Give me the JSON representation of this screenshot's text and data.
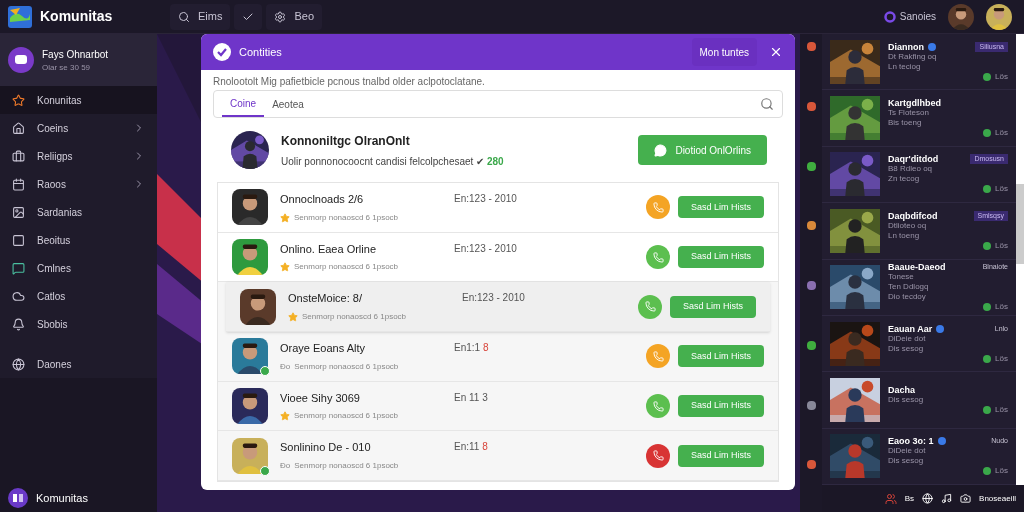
{
  "topbar": {
    "brand": "Komunitas",
    "nav": [
      {
        "label": "Eims"
      },
      {
        "kind": "icon"
      },
      {
        "label": "Beo"
      }
    ],
    "status": "Sanoies"
  },
  "sidebar": {
    "profile": {
      "name": "Fays Ohnarbot",
      "sub": "Olar se 30 59"
    },
    "items": [
      {
        "label": "Konunitas",
        "selected": true,
        "expandable": false
      },
      {
        "label": "Coeins",
        "selected": false,
        "expandable": true
      },
      {
        "label": "Reliigps",
        "selected": false,
        "expandable": true
      },
      {
        "label": "Raoos",
        "selected": false,
        "expandable": true
      },
      {
        "label": "Sardanias",
        "selected": false,
        "expandable": false
      },
      {
        "label": "Beoitus",
        "selected": false,
        "expandable": false
      },
      {
        "label": "Cmlnes",
        "selected": false,
        "expandable": false
      },
      {
        "label": "Catlos",
        "selected": false,
        "expandable": false
      },
      {
        "label": "Sbobis",
        "selected": false,
        "expandable": false
      },
      {
        "label": "Daones",
        "selected": false,
        "expandable": false
      }
    ],
    "footer": "Komunitas"
  },
  "modal": {
    "title": "Contities",
    "header_button": "Mon tuntes",
    "description": "Rnolootolt Mig pafietbicle pcnous tnalbd older aclpotoclatane.",
    "tabs": [
      {
        "label": "Coine",
        "selected": true
      },
      {
        "label": "Aeotea",
        "selected": false
      }
    ],
    "group": {
      "name": "Konnoniltgc OlranOnlt",
      "text": "Uolir ponnonocoocnt candisi felcolpchesaet ✔",
      "count": "280",
      "button": "Diotiod OnlOrlins"
    },
    "contacts": [
      {
        "name": "Onnoclnoads 2/6",
        "time": "En:123 - 2010",
        "sub": "Senmorp nonaoscd 6 1psocb",
        "star": true,
        "online": false,
        "selected": false,
        "color": "#f4a424",
        "button": "Sasd Lim Hists"
      },
      {
        "name": "Onlino. Eaea Orline",
        "time": "En:123 - 2010",
        "sub": "Senmorp nonaoscd 6 1psocb",
        "star": true,
        "online": false,
        "selected": false,
        "color": "#5cbf4f",
        "button": "Sasd Lim Hists"
      },
      {
        "name": "OnsteMoice: 8/",
        "time": "En:123 - 2010",
        "sub": "Senmorp nonaoscd 6 1psocb",
        "star": true,
        "online": false,
        "selected": true,
        "color": "#5cbf4f",
        "button": "Sasd Lim Hists"
      },
      {
        "name": "Oraye Eoans Alty",
        "time": "En1:1",
        "alert": "8",
        "prefix": "Ðo",
        "sub": "Senmorp nonaoscd 6 1psocb",
        "star": false,
        "online": true,
        "selected": false,
        "color": "#f4a424",
        "button": "Sasd Lim Hists"
      },
      {
        "name": "Vioee Sihy 3069",
        "time": "En 11 3",
        "sub": "Senmorp nonaoscd 6 1psocb",
        "star": true,
        "online": false,
        "selected": false,
        "color": "#5cbf4f",
        "button": "Sasd Lim Hists"
      },
      {
        "name": "Sonlinino De - 010",
        "time": "En:11",
        "alert": "8",
        "prefix": "Ðo",
        "sub": "Senmorp nonaoscd 6 1psocb",
        "star": false,
        "online": true,
        "selected": false,
        "color": "#d83434",
        "button": "Sasd Lim Hists"
      }
    ]
  },
  "games": [
    {
      "title": "Diannon",
      "verified": true,
      "tag": "Siliusna",
      "lines": [
        "Dt Rakfing oq",
        "Ln teciog"
      ],
      "players": "Lös",
      "color": "#d8573a"
    },
    {
      "title": "Kartgdlhbed",
      "verified": false,
      "lines": [
        "Ts Floteson",
        "Bis toeng"
      ],
      "players": "Lös",
      "color": "#d8573a"
    },
    {
      "title": "Daqr'ditdod",
      "verified": false,
      "tag": "Dmosusn",
      "lines": [
        "B8 Rdleo oq",
        "Zn tecog"
      ],
      "players": "Lös",
      "color": "#3fae3f"
    },
    {
      "title": "Daqbdifcod",
      "verified": false,
      "tag": "Smlsqsy",
      "lines": [
        "Dtlioteo oq",
        "Ln toeng"
      ],
      "players": "Lös",
      "color": "#d8893a"
    },
    {
      "title": "Baaue-Daeod",
      "verified": false,
      "note": "Blnaiote",
      "lines": [
        "Tonese",
        "Ten Ddlogq",
        "Dio tecdoy"
      ],
      "players": "Lös",
      "color": "#8a6fb0"
    },
    {
      "title": "Eauan Aar",
      "verified": true,
      "note": "Lnlo",
      "lines": [
        "DiDeie dot",
        "Dis sesog"
      ],
      "players": "Lös",
      "color": "#3fae3f"
    },
    {
      "title": "Dacha",
      "verified": false,
      "lines": [
        "Dis sesog"
      ],
      "players": "Lös",
      "color": "#888899"
    },
    {
      "title": "Eaoo 3o: 1",
      "verified": true,
      "note": "Nudo",
      "lines": [
        "DiDeie dot",
        "Dis sesog"
      ],
      "players": "Lös",
      "color": "#d8573a"
    }
  ],
  "statusbar": {
    "items": [
      "Bs",
      "Bnoseaeill"
    ]
  }
}
